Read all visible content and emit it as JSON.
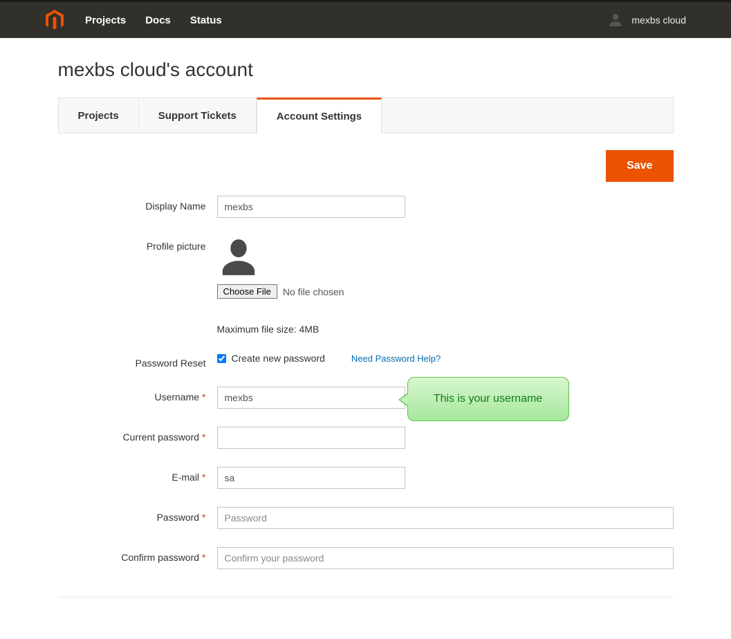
{
  "nav": {
    "projects": "Projects",
    "docs": "Docs",
    "status": "Status",
    "username": "mexbs cloud"
  },
  "page": {
    "title": "mexbs cloud's account"
  },
  "tabs": {
    "projects": "Projects",
    "support": "Support Tickets",
    "settings": "Account Settings"
  },
  "actions": {
    "save": "Save"
  },
  "form": {
    "display_name": {
      "label": "Display Name",
      "value": "mexbs"
    },
    "profile_picture": {
      "label": "Profile picture",
      "choose_file": "Choose File",
      "no_file": "No file chosen",
      "hint": "Maximum file size: 4MB"
    },
    "password_reset": {
      "label": "Password Reset",
      "checkbox_label": "Create new password",
      "help_link": "Need Password Help?"
    },
    "username": {
      "label": "Username",
      "value": "mexbs"
    },
    "current_password": {
      "label": "Current password"
    },
    "email": {
      "label": "E-mail",
      "value": "sa"
    },
    "password": {
      "label": "Password",
      "placeholder": "Password"
    },
    "confirm_password": {
      "label": "Confirm password",
      "placeholder": "Confirm your password"
    }
  },
  "callout": {
    "text": "This is your username"
  }
}
